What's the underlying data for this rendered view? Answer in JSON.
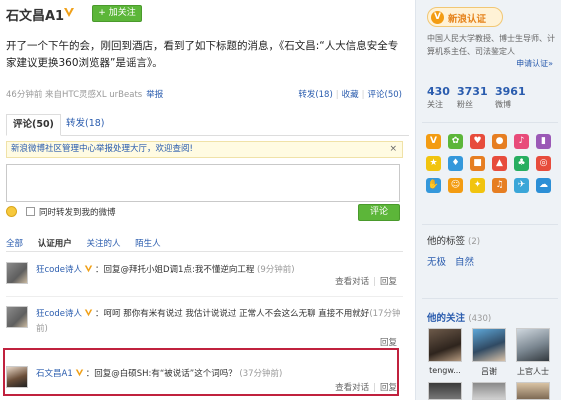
{
  "profile": {
    "name": "石文昌A1",
    "follow_label": "+ 加关注"
  },
  "post": {
    "text": "开了一个下午的会，刚回到酒店，看到了如下标题的消息，《石文昌:“人大信息安全专家建议更换360浏览器”是谣言》。",
    "meta": "46分钟前 来自HTC灵感XL urBeats",
    "report": "举报",
    "repost": "转发(18)",
    "favorite": "收藏",
    "comment": "评论(50)"
  },
  "tabs": {
    "comments": "评论(50)",
    "reposts": "转发(18)"
  },
  "notice": {
    "text": "新浪微博社区管理中心举报处理大厅，欢迎查阅!",
    "close": "×"
  },
  "composer": {
    "checkbox_label": "同时转发到我的微博",
    "submit_label": "评论"
  },
  "filters": [
    "全部",
    "认证用户",
    "关注的人",
    "陌生人"
  ],
  "comments": [
    {
      "user": "狂code诗人",
      "text": "：回复@拜托小姐D调1点:我不懂逆向工程",
      "time": "(9分钟前)",
      "view_dialog": "查看对话",
      "reply": "回复"
    },
    {
      "user": "狂code诗人",
      "text": "：呵呵 那你有米有说过 我估计说说过 正常人不会这么无聊 直接不用就好",
      "time": "(17分钟前)",
      "view_dialog": "",
      "reply": "回复"
    },
    {
      "user": "石文昌A1",
      "text": "：回复@白硕SH:有“被说话”这个词吗？",
      "time": "(37分钟前)",
      "view_dialog": "查看对话",
      "reply": "回复"
    }
  ],
  "sidebar": {
    "verify_label": "新浪认证",
    "verify_desc": "中国人民大学教授、博士生导师、计算机系主任、司法鉴定人",
    "verify_link": "申请认证»",
    "stats": [
      {
        "num": "430",
        "label": "关注"
      },
      {
        "num": "3731",
        "label": "粉丝"
      },
      {
        "num": "3961",
        "label": "微博"
      }
    ],
    "tags_title": "他的标签",
    "tags_count": "(2)",
    "tags": [
      "无极",
      "自然"
    ],
    "follow_title": "他的关注",
    "follow_count": "(430)",
    "follows": [
      "tengw...",
      "吕谢",
      "上官人士"
    ]
  },
  "colors": {
    "accent_green": "#5cb639",
    "link_blue": "#2a5cae",
    "highlight_red": "#c0213e",
    "verify_orange": "#f39c12"
  }
}
